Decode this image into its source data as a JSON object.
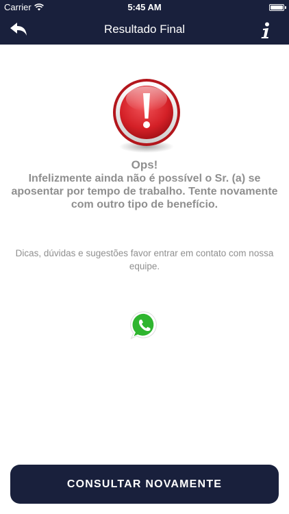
{
  "status_bar": {
    "carrier": "Carrier",
    "time": "5:45 AM",
    "wifi_icon": "wifi-icon",
    "battery_icon": "battery-icon"
  },
  "nav": {
    "title": "Resultado Final",
    "back_icon": "reply-arrow-icon",
    "info_icon": "info-icon"
  },
  "result": {
    "alert_icon": "exclamation-alert-icon",
    "title": "Ops!",
    "message": "Infelizmente ainda não é possível o Sr. (a) se aposentar por tempo de trabalho. Tente novamente com outro tipo de benefício."
  },
  "contact": {
    "tips": "Dicas, dúvidas e sugestões favor entrar em contato com nossa equipe.",
    "whatsapp_icon": "whatsapp-icon"
  },
  "footer": {
    "button_label": "CONSULTAR NOVAMENTE"
  },
  "colors": {
    "header_bg": "#19203c",
    "button_bg": "#19203c",
    "text_gray": "#8f8f8f",
    "alert_red": "#d42027",
    "whatsapp_green": "#2fb52f"
  }
}
